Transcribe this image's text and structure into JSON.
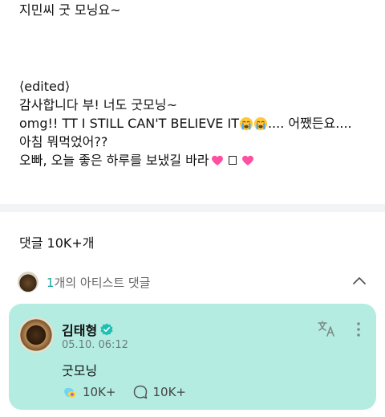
{
  "post": {
    "greeting": "지민씨 굿 모닝요~",
    "edited_tag": "⟨edited⟩",
    "line1": "감사합니다 부! 너도 굿모닝~",
    "line2_a": "omg!! TT I STILL CAN'T BELIEVE IT",
    "line2_b": ".... 어쨌든요....",
    "line3": "아침 뭐먹었어??",
    "line4": "오빠, 오늘 좋은 하루를 보냈길 바라"
  },
  "comments": {
    "count_label": "댓글 10K+개",
    "artist_count": "1",
    "artist_label": "개의 아티스트 댓글"
  },
  "artist_comment": {
    "name": "김태형",
    "time": "05.10. 06:12",
    "text": "굿모닝",
    "like_count": "10K+",
    "reply_count": "10K+"
  },
  "colors": {
    "card_bg": "#b4ece2",
    "accent": "#1aa6a0",
    "heart": "#ff4fa0"
  }
}
